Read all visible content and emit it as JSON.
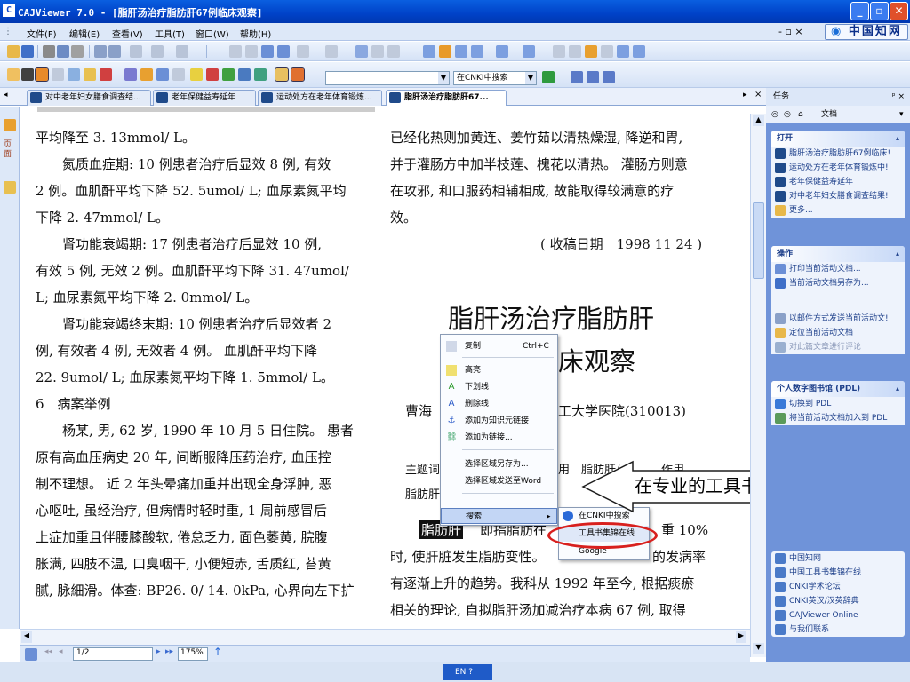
{
  "window": {
    "title": "CAJViewer 7.0 - [脂肝汤治疗脂肪肝67例临床观察]",
    "app_icon": "cajviewer-icon"
  },
  "menubar": {
    "items": [
      "文件(F)",
      "编辑(E)",
      "查看(V)",
      "工具(T)",
      "窗口(W)",
      "帮助(H)"
    ],
    "mdi_controls": "- ▫ ×",
    "cnki_link": "中国知网"
  },
  "toolbar3": {
    "search_combo": "在CNKI中搜索"
  },
  "tabs": [
    {
      "label": "对中老年妇女膳食调查结..."
    },
    {
      "label": "老年保健益寿延年"
    },
    {
      "label": "运动处方在老年体育锻炼..."
    },
    {
      "label": "脂肝汤治疗脂肪肝67..."
    }
  ],
  "document": {
    "left_column": [
      "平均降至 3. 13mmol/ L。",
      "　　氮质血症期: 10 例患者治疗后显效 8 例, 有效",
      "2 例。血肌酐平均下降 52. 5umol/ L; 血尿素氮平均",
      "下降 2. 47mmol/ L。",
      "　　肾功能衰竭期: 17 例患者治疗后显效 10 例,",
      "有效 5 例, 无效 2 例。血肌酐平均下降 31. 47umol/",
      "L; 血尿素氮平均下降 2. 0mmol/ L。",
      "　　肾功能衰竭终末期: 10 例患者治疗后显效者 2",
      "例, 有效者 4 例, 无效者 4 例。 血肌酐平均下降",
      "22. 9umol/ L; 血尿素氮平均下降 1. 5mmol/ L。",
      "6　病案举例",
      "　　杨某, 男, 62 岁, 1990 年 10 月 5 日住院。 患者",
      "原有高血压病史 20 年, 间断服降压药治疗, 血压控",
      "制不理想。 近 2 年头晕痛加重并出现全身浮肿, 恶",
      "心呕吐, 虽经治疗, 但病情时轻时重, 1 周前感冒后",
      "上症加重且伴腰膝酸软, 倦怠乏力, 面色萎黄, 脘腹",
      "胀满, 四肢不温, 口臭咽干, 小便短赤, 舌质红, 苔黄",
      "腻, 脉細滑。体查: BP26. 0/ 14. 0kPa, 心界向左下扩"
    ],
    "right_column": [
      "已经化热则加黄连、姜竹茹以清热燥湿, 降逆和胃,",
      "并于灌肠方中加半枝莲、槐花以清热。 灌肠方则意",
      "在攻邪, 和口服药相辅相成, 故能取得较满意的疗",
      "效。"
    ],
    "received_date": "( 收稿日期　1998 11 24 )",
    "article_title_line1": "脂肝汤治疗脂肪肝",
    "article_title_line2": "床观察",
    "author_prefix": "曹海",
    "author_affil": "工大学医院(310013)",
    "keywords_prefix": "主题词",
    "keywords_mid": "用　脂肪肝/",
    "keywords_end": "作用",
    "keywords_line2": "脂肪肝",
    "body_highlight": "脂肪肝",
    "body_line1_a": "即指脂肪在",
    "body_line1_b": "重 10%",
    "body_line2_a": "时, 使肝脏发生脂肪变性。",
    "body_line2_b": "的发病率",
    "body_line3": "有逐渐上升的趋势。我科从 1992 年至今, 根据痰瘀",
    "body_line4": "相关的理论, 自拟脂肝汤加减治疗本病 67 例, 取得"
  },
  "context_menu": {
    "items": [
      {
        "label": "复制",
        "shortcut": "Ctrl+C",
        "icon": "copy-icon"
      },
      {
        "label": "高亮",
        "icon": "highlight-icon"
      },
      {
        "label": "下划线",
        "icon": "underline-icon"
      },
      {
        "label": "删除线",
        "icon": "strikethrough-icon"
      },
      {
        "label": "添加为知识元链接",
        "icon": "anchor-icon"
      },
      {
        "label": "添加为链接...",
        "icon": "link-icon"
      },
      {
        "label": "选择区域另存为..."
      },
      {
        "label": "选择区域发送至Word"
      },
      {
        "label": "搜索",
        "submenu_arrow": "▸"
      }
    ]
  },
  "submenu": {
    "items": [
      "在CNKI中搜索",
      "工具书集锦在线",
      "Google"
    ]
  },
  "callout": "在专业的工具书数据库中",
  "statusbar": {
    "page": "1/2",
    "zoom": "175%"
  },
  "ime": "EN",
  "taskpane": {
    "title": "任务",
    "close": "ᵖ ×",
    "nav_label": "文档",
    "sections": [
      {
        "header": "打开",
        "items": [
          "脂肝汤治疗脂肪肝67例临床!",
          "运动处方在老年体育锻炼中!",
          "老年保健益寿延年",
          "对中老年妇女膳食调查结果!",
          "更多..."
        ]
      },
      {
        "header": "操作",
        "items": [
          "打印当前活动文档...",
          "当前活动文档另存为...",
          "以邮件方式发送当前活动文!",
          "定位当前活动文档",
          "对此篇文章进行评论"
        ]
      },
      {
        "header": "个人数字图书馆 (PDL)",
        "items": [
          "切换到 PDL",
          "将当前活动文档加入到 PDL"
        ]
      },
      {
        "header": "",
        "items": [
          "中国知网",
          "中国工具书集锦在线",
          "CNKI学术论坛",
          "CNKI英汉/汉英辞典",
          "CAJViewer Online",
          "与我们联系"
        ]
      }
    ]
  },
  "colors": {
    "title_bar": "#0042c8",
    "callout_border": "#1d1d1d",
    "highlight_oval": "#d8201e",
    "task_pane_bg": "#6f93d9"
  }
}
